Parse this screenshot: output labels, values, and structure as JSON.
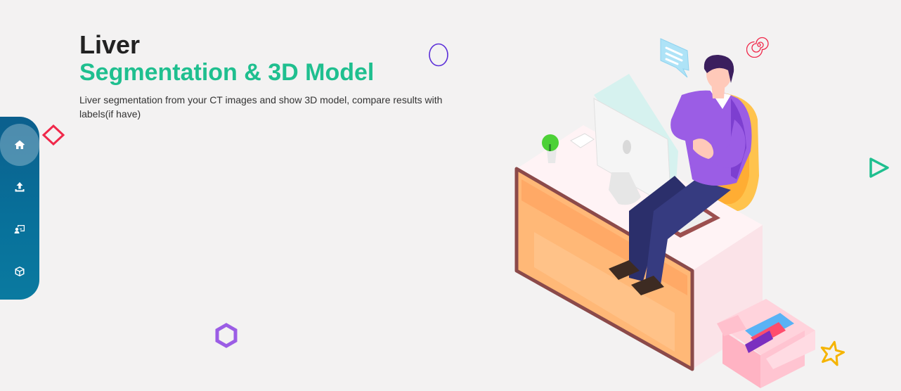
{
  "hero": {
    "title_line1": "Liver",
    "title_line2": "Segmentation & 3D Model",
    "description": "Liver segmentation from your CT images and show 3D model, compare results with labels(if have)"
  },
  "sidebar": {
    "items": [
      {
        "icon": "home-icon",
        "active": true
      },
      {
        "icon": "upload-icon",
        "active": false
      },
      {
        "icon": "compare-icon",
        "active": false
      },
      {
        "icon": "cube-icon",
        "active": false
      }
    ]
  },
  "colors": {
    "title": "#222222",
    "accent": "#1fbf8f",
    "sidebar": "#0b5f8d",
    "background": "#f3f2f2"
  }
}
